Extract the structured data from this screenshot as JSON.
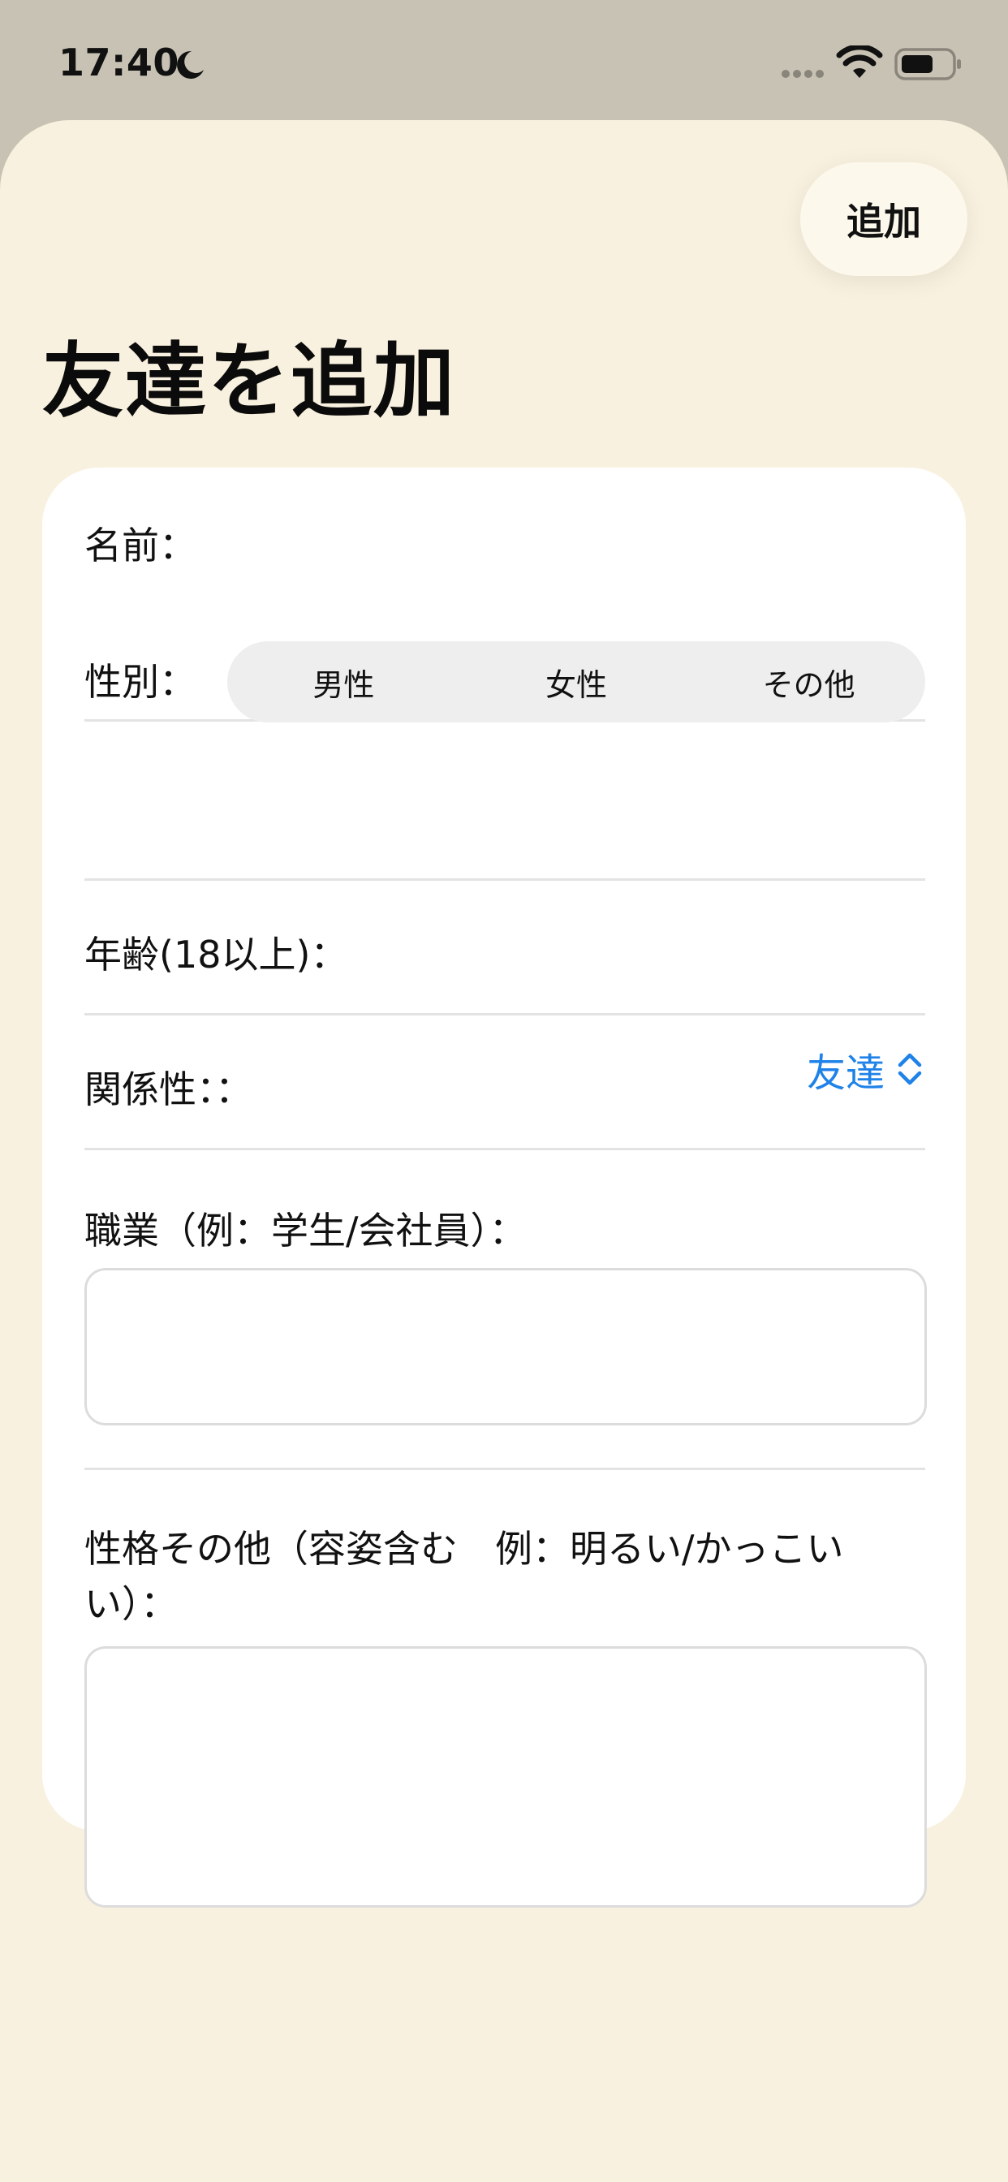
{
  "status_bar": {
    "time": "17:40",
    "moon_icon": "moon-icon",
    "signal_icon": "cellular-signal-icon",
    "wifi_icon": "wifi-icon",
    "battery_icon": "battery-icon"
  },
  "header": {
    "add_button_label": "追加",
    "title": "友達を追加"
  },
  "form": {
    "name_label": "名前：",
    "gender": {
      "label": "性別：",
      "options": [
        "男性",
        "女性",
        "その他"
      ]
    },
    "age_label": "年齢(18以上)：",
    "relationship": {
      "label": "関係性：：",
      "value": "友達"
    },
    "occupation_label": "職業（例：学生/会社員）：",
    "personality_label": "性格その他（容姿含む　例：明るい/かっこいい）："
  },
  "colors": {
    "sheet_background": "#f9f1df",
    "top_background": "#c8c2b4",
    "accent": "#1f82e8"
  }
}
